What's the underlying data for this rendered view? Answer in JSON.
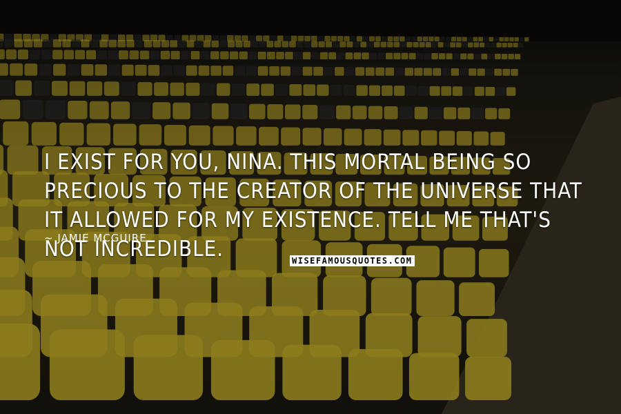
{
  "quote": {
    "text": "I exist for you, Nina. This mortal being so precious to the Creator of the Universe that it allowed for my existence. Tell me that's not incredible.",
    "author": "~ Jamie McGuire"
  },
  "watermark": {
    "text": "WISEFAMOUSQUOTES.COM"
  },
  "background": {
    "subject": "rows of yellow and black stadium seats",
    "seat_color": "#c9b22a",
    "dark_seat_color": "#2b2b2b"
  }
}
